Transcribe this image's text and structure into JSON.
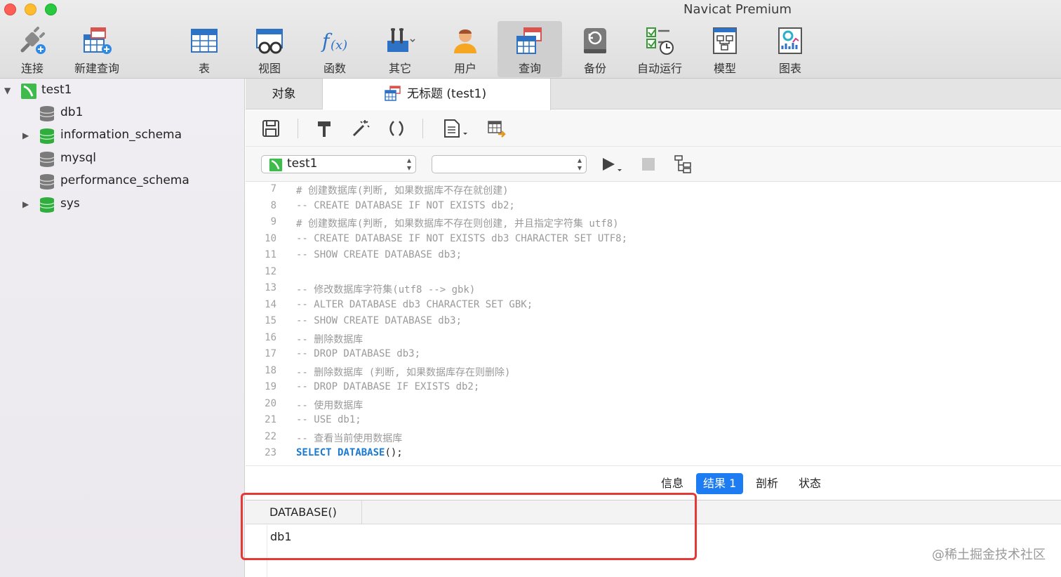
{
  "window": {
    "title": "Navicat Premium"
  },
  "toolbar": {
    "items": [
      {
        "label": "连接",
        "icon": "plug-connect-icon"
      },
      {
        "label": "新建查询",
        "icon": "new-query-icon"
      },
      {
        "label": "表",
        "icon": "table-icon"
      },
      {
        "label": "视图",
        "icon": "view-icon"
      },
      {
        "label": "函数",
        "icon": "function-icon"
      },
      {
        "label": "其它",
        "icon": "tools-icon"
      },
      {
        "label": "用户",
        "icon": "user-icon"
      },
      {
        "label": "查询",
        "icon": "query-icon",
        "active": true
      },
      {
        "label": "备份",
        "icon": "backup-icon"
      },
      {
        "label": "自动运行",
        "icon": "automation-icon"
      },
      {
        "label": "模型",
        "icon": "model-icon"
      },
      {
        "label": "图表",
        "icon": "chart-icon"
      }
    ]
  },
  "sidebar": {
    "connection": "test1",
    "databases": [
      {
        "name": "db1",
        "expandable": false,
        "open": false
      },
      {
        "name": "information_schema",
        "expandable": true,
        "open": true
      },
      {
        "name": "mysql",
        "expandable": false,
        "open": false
      },
      {
        "name": "performance_schema",
        "expandable": false,
        "open": false
      },
      {
        "name": "sys",
        "expandable": true,
        "open": true
      }
    ]
  },
  "tabs": {
    "objects": "对象",
    "query": "无标题 (test1)"
  },
  "selectors": {
    "connection": "test1",
    "database": ""
  },
  "editor": {
    "lines": [
      {
        "n": "7",
        "text": "# 创建数据库(判断, 如果数据库不存在就创建)"
      },
      {
        "n": "8",
        "text": "-- CREATE DATABASE IF NOT EXISTS db2;"
      },
      {
        "n": "9",
        "text": "# 创建数据库(判断, 如果数据库不存在则创建, 并且指定字符集 utf8)"
      },
      {
        "n": "10",
        "text": "-- CREATE DATABASE IF NOT EXISTS db3 CHARACTER SET UTF8;"
      },
      {
        "n": "11",
        "text": "-- SHOW CREATE DATABASE db3;"
      },
      {
        "n": "12",
        "text": ""
      },
      {
        "n": "13",
        "text": "-- 修改数据库字符集(utf8 --> gbk)"
      },
      {
        "n": "14",
        "text": "-- ALTER DATABASE db3 CHARACTER SET GBK;"
      },
      {
        "n": "15",
        "text": "-- SHOW CREATE DATABASE db3;"
      },
      {
        "n": "16",
        "text": "-- 删除数据库"
      },
      {
        "n": "17",
        "text": "-- DROP DATABASE db3;"
      },
      {
        "n": "18",
        "text": "-- 删除数据库 (判断, 如果数据库存在则删除)"
      },
      {
        "n": "19",
        "text": "-- DROP DATABASE IF EXISTS db2;"
      },
      {
        "n": "20",
        "text": "-- 使用数据库"
      },
      {
        "n": "21",
        "text": "-- USE db1;"
      },
      {
        "n": "22",
        "text": "-- 查看当前使用数据库"
      }
    ],
    "last_line": {
      "n": "23",
      "kw1": "SELECT",
      "kw2": "DATABASE",
      "rest": "();"
    }
  },
  "result_tabs": [
    {
      "label": "信息",
      "active": false
    },
    {
      "label": "结果 1",
      "active": true
    },
    {
      "label": "剖析",
      "active": false
    },
    {
      "label": "状态",
      "active": false
    }
  ],
  "grid": {
    "columns": [
      "DATABASE()"
    ],
    "rows": [
      [
        "db1"
      ]
    ]
  },
  "watermark": "@稀土掘金技术社区",
  "colors": {
    "accent": "#1d7cf2",
    "highlight": "#e53935",
    "keyword": "#1a7ad1"
  }
}
